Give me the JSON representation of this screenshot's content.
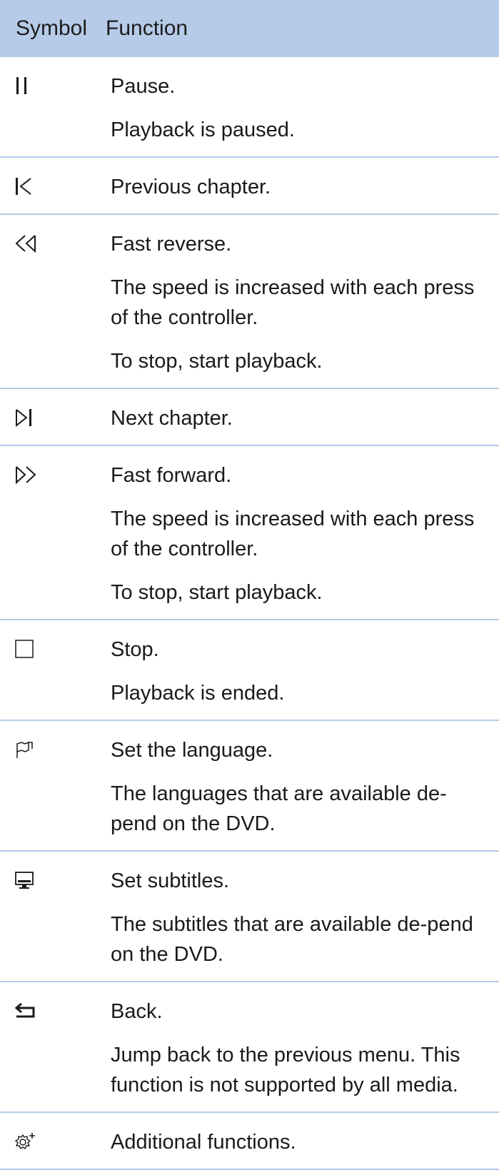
{
  "header": {
    "symbol_label": "Symbol",
    "function_label": "Function"
  },
  "rows": [
    {
      "icon": "pause-icon",
      "lines": [
        "Pause.",
        "Playback is paused."
      ]
    },
    {
      "icon": "previous-chapter-icon",
      "lines": [
        "Previous chapter."
      ]
    },
    {
      "icon": "fast-reverse-icon",
      "lines": [
        "Fast reverse.",
        "The speed is increased with each press of the controller.",
        "To stop, start playback."
      ]
    },
    {
      "icon": "next-chapter-icon",
      "lines": [
        "Next chapter."
      ]
    },
    {
      "icon": "fast-forward-icon",
      "lines": [
        "Fast forward.",
        "The speed is increased with each press of the controller.",
        "To stop, start playback."
      ]
    },
    {
      "icon": "stop-icon",
      "lines": [
        "Stop.",
        "Playback is ended."
      ]
    },
    {
      "icon": "language-icon",
      "lines": [
        "Set the language.",
        "The languages that are available de-pend on the DVD."
      ]
    },
    {
      "icon": "subtitles-icon",
      "lines": [
        "Set subtitles.",
        "The subtitles that are available de-pend on the DVD."
      ]
    },
    {
      "icon": "back-arrow-icon",
      "lines": [
        "Back.",
        "Jump back to the previous menu. This function is not supported by all media."
      ]
    },
    {
      "icon": "additional-functions-icon",
      "lines": [
        "Additional functions."
      ]
    }
  ],
  "colors": {
    "header_background": "#b5cbe7",
    "divider": "#b5cbe7",
    "text": "#1a1a1a"
  }
}
